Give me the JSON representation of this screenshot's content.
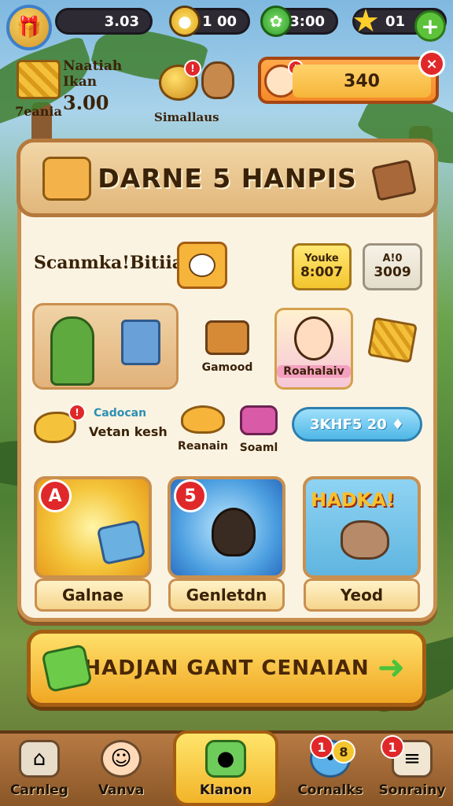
{
  "top_bar": {
    "resource_1": "3.03",
    "resource_2": "1 00",
    "resource_3": "3:00",
    "resource_4": "01",
    "icons": [
      "treasure-avatar",
      "gold-coin",
      "green-gem",
      "star"
    ],
    "add_label": "+"
  },
  "header_row": {
    "crate_caption": "7eania",
    "title_text": "Naatiah Ikan",
    "title_value": "3.00",
    "coins_badge": "!",
    "coins_caption": "Simallaus",
    "cash_value": "340",
    "cash_badge": "!",
    "close_label": "×"
  },
  "panel": {
    "title": "DARNE 5 HANPIS",
    "section_label": "Scanmka!Bitiia",
    "price_1_top": "Youke",
    "price_1_bottom": "8:007",
    "price_2_top": "A!0",
    "price_2_bottom": "3009",
    "item_captions": [
      "Gamood",
      "Roahalaiv"
    ],
    "row3_label_top": "Cadocan",
    "row3_label_bottom": "Vetan kesh",
    "row3_badge": "!",
    "row3_caption_1": "Reanain",
    "row3_caption_2": "Soaml",
    "pill_button": "3KHF5 20",
    "cards": [
      {
        "badge": "A",
        "button": "Galnae",
        "art": "sunburst-treasure"
      },
      {
        "badge": "5",
        "button": "Genletdn",
        "art": "blue-monster"
      },
      {
        "headline": "HADKA!",
        "button": "Yeod",
        "art": "elephant"
      }
    ]
  },
  "main_button": "HADJAN GANT CENAIAN",
  "bottom_nav": [
    {
      "label": "Carnleg",
      "icon": "home-icon"
    },
    {
      "label": "Vanva",
      "icon": "character-icon"
    },
    {
      "label": "Klanon",
      "icon": "chest-icon",
      "active": true
    },
    {
      "label": "Cornalks",
      "icon": "chat-icon",
      "badges": [
        "1",
        "8"
      ]
    },
    {
      "label": "Sonrainy",
      "icon": "scroll-icon",
      "badges": [
        "1"
      ]
    }
  ],
  "colors": {
    "panel_bg": "#fbf3e2",
    "wood_border": "#c98f4f",
    "accent_yellow": "#f2b428",
    "accent_red": "#e0282a",
    "accent_green": "#5cc23a",
    "pill_blue": "#6cc7ef"
  }
}
